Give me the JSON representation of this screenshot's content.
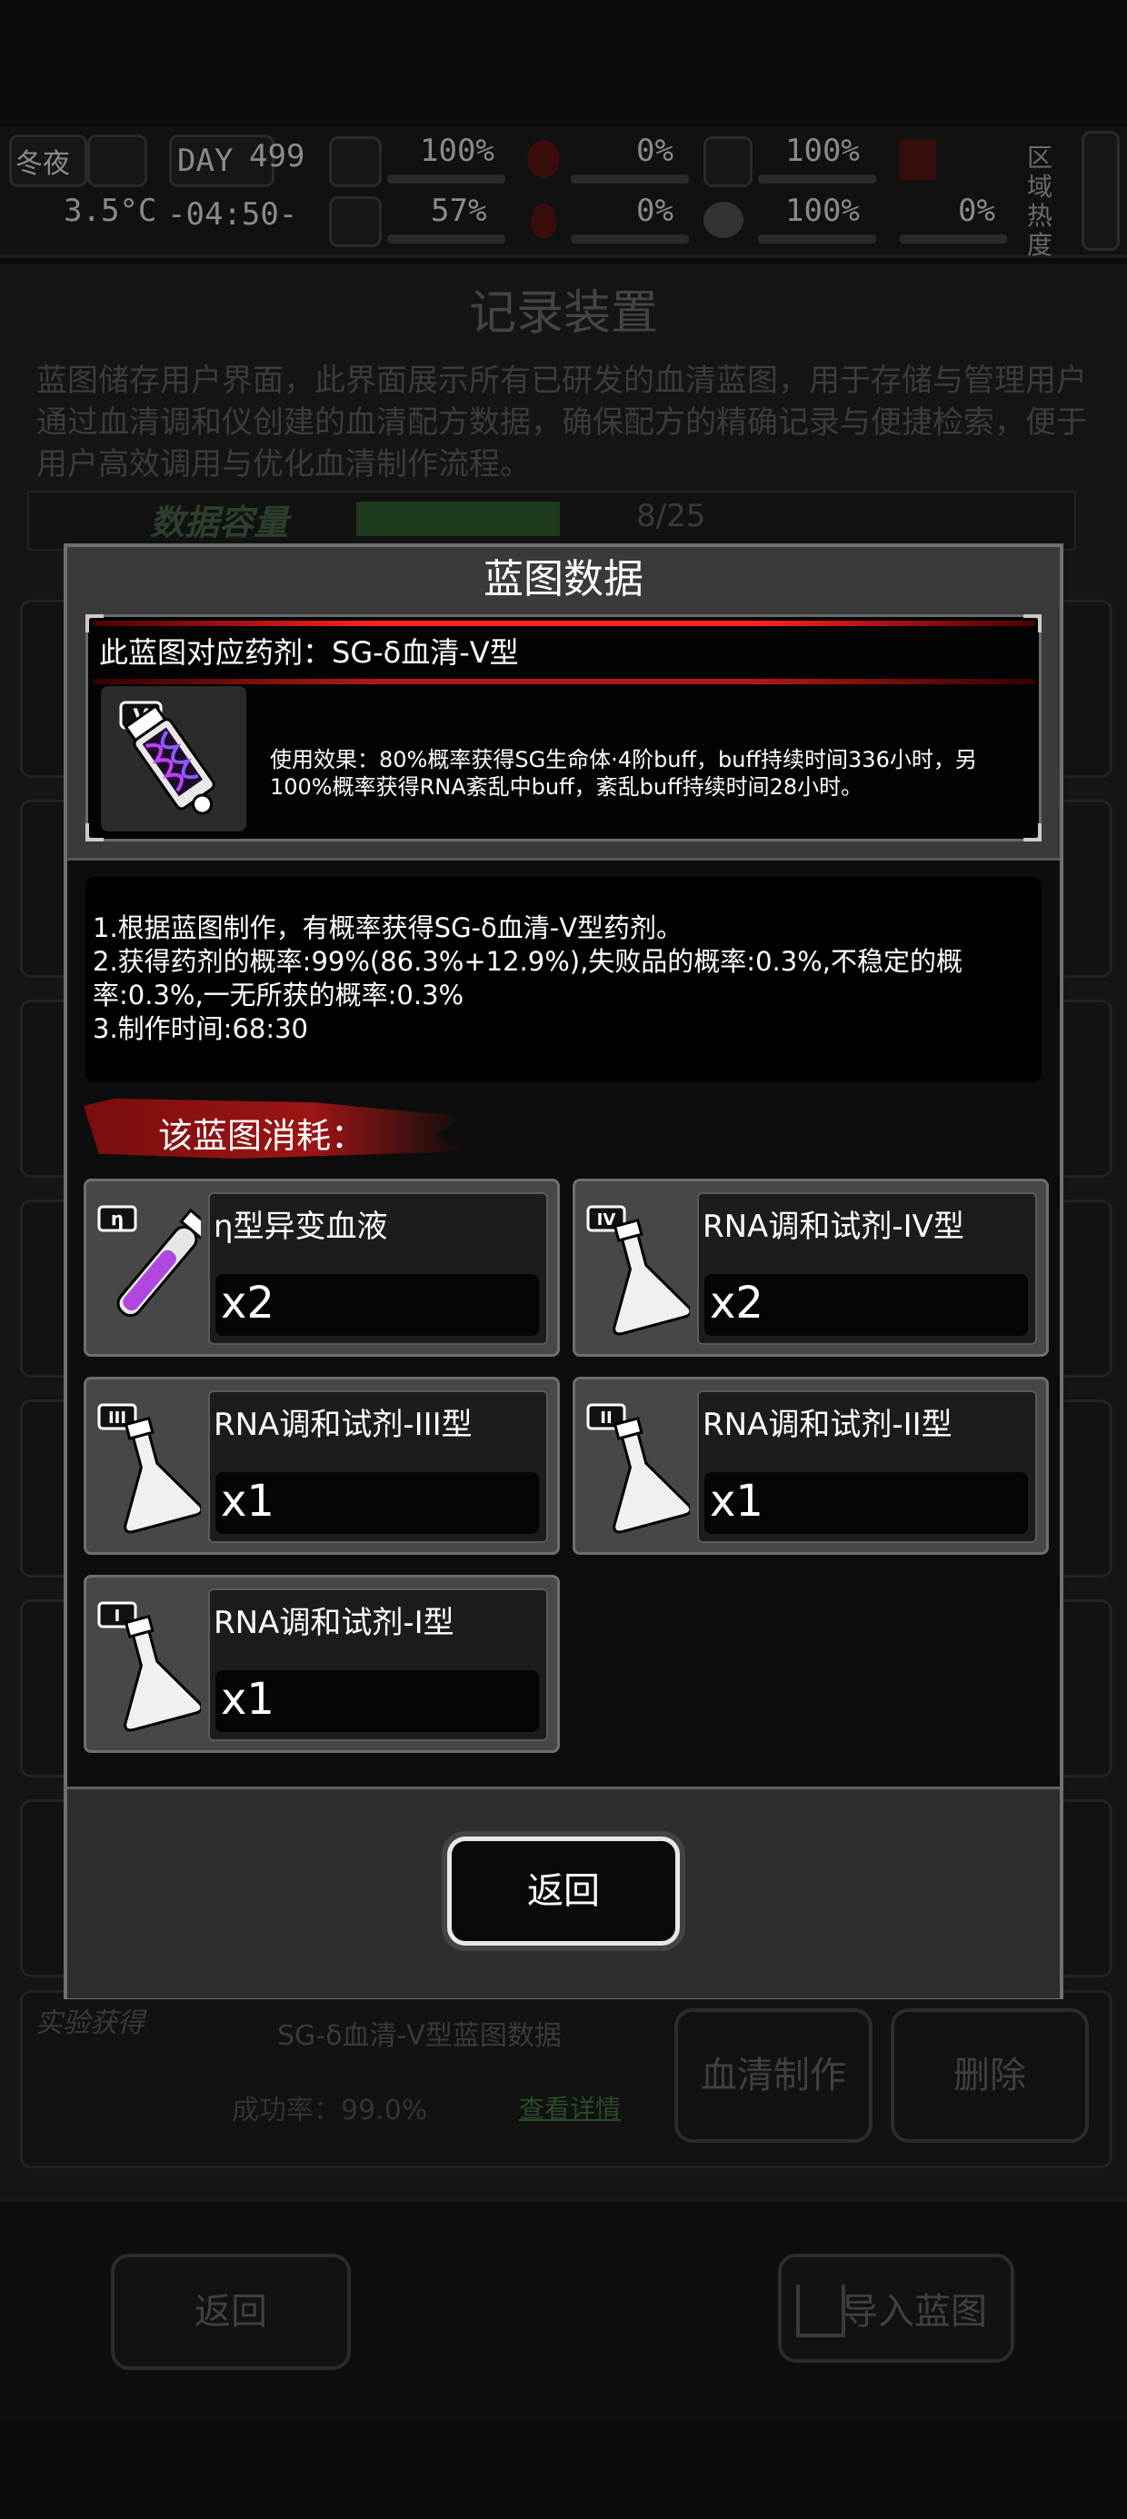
{
  "background": {
    "hud": {
      "season": "冬夜",
      "temperature": "3.5°C",
      "day_label": "DAY",
      "day_number": "499",
      "clock": "-04:50-",
      "stat_1": "100%",
      "stat_2": "0%",
      "stat_3": "100%",
      "stat_4": "57%",
      "stat_5": "0%",
      "stat_6": "100%",
      "stat_7": "0%",
      "area_heat": "区域热度"
    },
    "title": "记录装置",
    "description": "蓝图储存用户界面，此界面展示所有已研发的血清蓝图，用于存储与管理用户通过血清调和仪创建的血清配方数据，确保配方的精确记录与便捷检索，便于用户高效调用与优化血清制作流程。",
    "capacity_label": "数据容量",
    "capacity_value": "8/25",
    "capacity_fraction": 0.32,
    "card": {
      "source": "实验获得",
      "name": "SG-δ血清-V型蓝图数据",
      "success_rate": "成功率：99.0%",
      "detail_link": "查看详情",
      "make_button": "血清制作",
      "delete_button": "删除"
    },
    "back_button": "返回",
    "import_button": "导入蓝图"
  },
  "modal": {
    "title": "蓝图数据",
    "header": "此蓝图对应药剂：SG-δ血清-V型",
    "item_badge": "V",
    "effect": "使用效果：80%概率获得SG生命体·4阶buff，buff持续时间336小时，另100%概率获得RNA紊乱中buff，紊乱buff持续时间28小时。",
    "craft_lines": [
      "1.根据蓝图制作，有概率获得SG-δ血清-V型药剂。",
      "2.获得药剂的概率:99%(86.3%+12.9%),失败品的概率:0.3%,不稳定的概",
      "率:0.3%,一无所获的概率:0.3%",
      "3.制作时间:68:30"
    ],
    "consume_title": "该蓝图消耗：",
    "materials": [
      {
        "badge": "η",
        "name": "η型异变血液",
        "qty": "x2"
      },
      {
        "badge": "IV",
        "name": "RNA调和试剂-IV型",
        "qty": "x2"
      },
      {
        "badge": "III",
        "name": "RNA调和试剂-III型",
        "qty": "x1"
      },
      {
        "badge": "II",
        "name": "RNA调和试剂-II型",
        "qty": "x1"
      },
      {
        "badge": "I",
        "name": "RNA调和试剂-I型",
        "qty": "x1"
      }
    ],
    "back_label": "返回"
  }
}
